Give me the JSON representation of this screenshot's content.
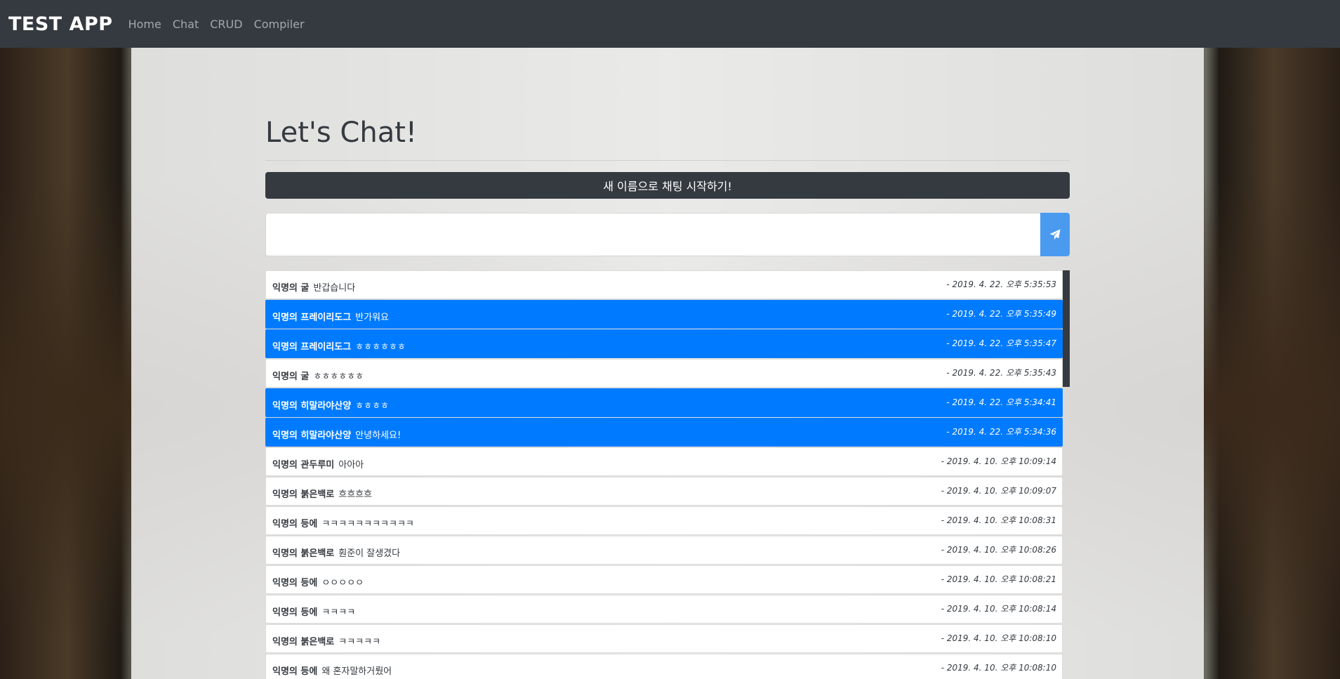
{
  "navbar": {
    "brand": "TEST APP",
    "links": [
      "Home",
      "Chat",
      "CRUD",
      "Compiler"
    ]
  },
  "page": {
    "title": "Let's Chat!",
    "new_name_button": "새 이름으로 채팅 시작하기!",
    "input_placeholder": "",
    "send_icon": "paper-plane-icon"
  },
  "colors": {
    "navbar": "#343a40",
    "accent": "#007bff",
    "send_button": "#4a9bf0"
  },
  "messages": [
    {
      "name": "익명의 굴",
      "text": "반갑습니다",
      "time": "- 2019. 4. 22. 오후 5:35:53",
      "mine": false
    },
    {
      "name": "익명의 프레이리도그",
      "text": "반가워요",
      "time": "- 2019. 4. 22. 오후 5:35:49",
      "mine": true
    },
    {
      "name": "익명의 프레이리도그",
      "text": "ㅎㅎㅎㅎㅎㅎ",
      "time": "- 2019. 4. 22. 오후 5:35:47",
      "mine": true
    },
    {
      "name": "익명의 굴",
      "text": "ㅎㅎㅎㅎㅎㅎ",
      "time": "- 2019. 4. 22. 오후 5:35:43",
      "mine": false
    },
    {
      "name": "익명의 히말라야산양",
      "text": "ㅎㅎㅎㅎ",
      "time": "- 2019. 4. 22. 오후 5:34:41",
      "mine": true
    },
    {
      "name": "익명의 히말라야산양",
      "text": "안녕하세요!",
      "time": "- 2019. 4. 22. 오후 5:34:36",
      "mine": true
    },
    {
      "name": "익명의 관두루미",
      "text": "아아아",
      "time": "- 2019. 4. 10. 오후 10:09:14",
      "mine": false
    },
    {
      "name": "익명의 붉은백로",
      "text": "흐흐흐흐",
      "time": "- 2019. 4. 10. 오후 10:09:07",
      "mine": false
    },
    {
      "name": "익명의 등에",
      "text": "ㅋㅋㅋㅋㅋㅋㅋㅋㅋㅋㅋ",
      "time": "- 2019. 4. 10. 오후 10:08:31",
      "mine": false
    },
    {
      "name": "익명의 붉은백로",
      "text": "훤준이 잘생겼다",
      "time": "- 2019. 4. 10. 오후 10:08:26",
      "mine": false
    },
    {
      "name": "익명의 등에",
      "text": "ㅇㅇㅇㅇㅇ",
      "time": "- 2019. 4. 10. 오후 10:08:21",
      "mine": false
    },
    {
      "name": "익명의 등에",
      "text": "ㅋㅋㅋㅋ",
      "time": "- 2019. 4. 10. 오후 10:08:14",
      "mine": false
    },
    {
      "name": "익명의 붉은백로",
      "text": "ㅋㅋㅋㅋㅋ",
      "time": "- 2019. 4. 10. 오후 10:08:10",
      "mine": false
    },
    {
      "name": "익명의 등에",
      "text": "왜 혼자말하거뤘어",
      "time": "- 2019. 4. 10. 오후 10:08:10",
      "mine": false
    }
  ]
}
